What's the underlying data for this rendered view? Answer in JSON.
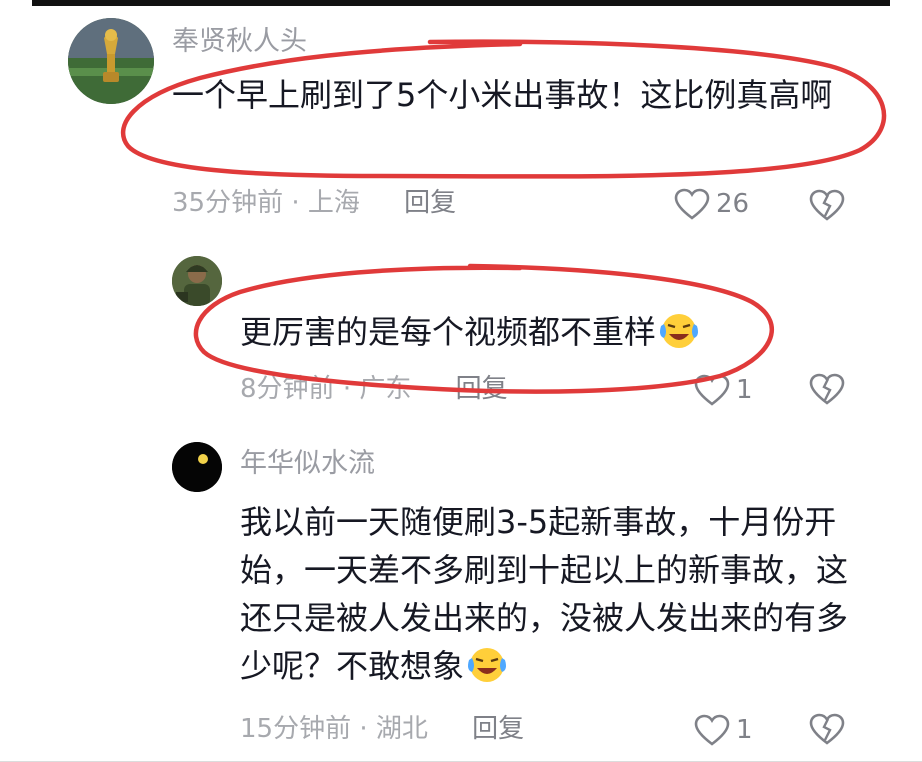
{
  "comments": [
    {
      "username": "奉贤秋人头",
      "text": "一个早上刷到了5个小米出事故！这比例真高啊",
      "time": "35分钟前",
      "location": "上海",
      "reply_label": "回复",
      "likes": "26",
      "avatar_icon": "trophy-avatar-icon"
    },
    {
      "username": "",
      "text": "更厉害的是每个视频都不重样",
      "time": "8分钟前",
      "location": "广东",
      "reply_label": "回复",
      "likes": "1",
      "avatar_icon": "soldier-avatar-icon",
      "emoji": "laugh-cry-emoji-icon"
    },
    {
      "username": "年华似水流",
      "text": "我以前一天随便刷3-5起新事故，十月份开始，一天差不多刷到十起以上的新事故，这还只是被人发出来的，没被人发出来的有多少呢？不敢想象",
      "time": "15分钟前",
      "location": "湖北",
      "reply_label": "回复",
      "likes": "1",
      "avatar_icon": "black-circle-avatar-icon",
      "emoji": "laugh-cry-emoji-icon"
    }
  ],
  "meta_separator": "·",
  "colors": {
    "annotation_red": "#e03a3a",
    "meta_gray": "#a7a9ae",
    "text": "#161823"
  }
}
